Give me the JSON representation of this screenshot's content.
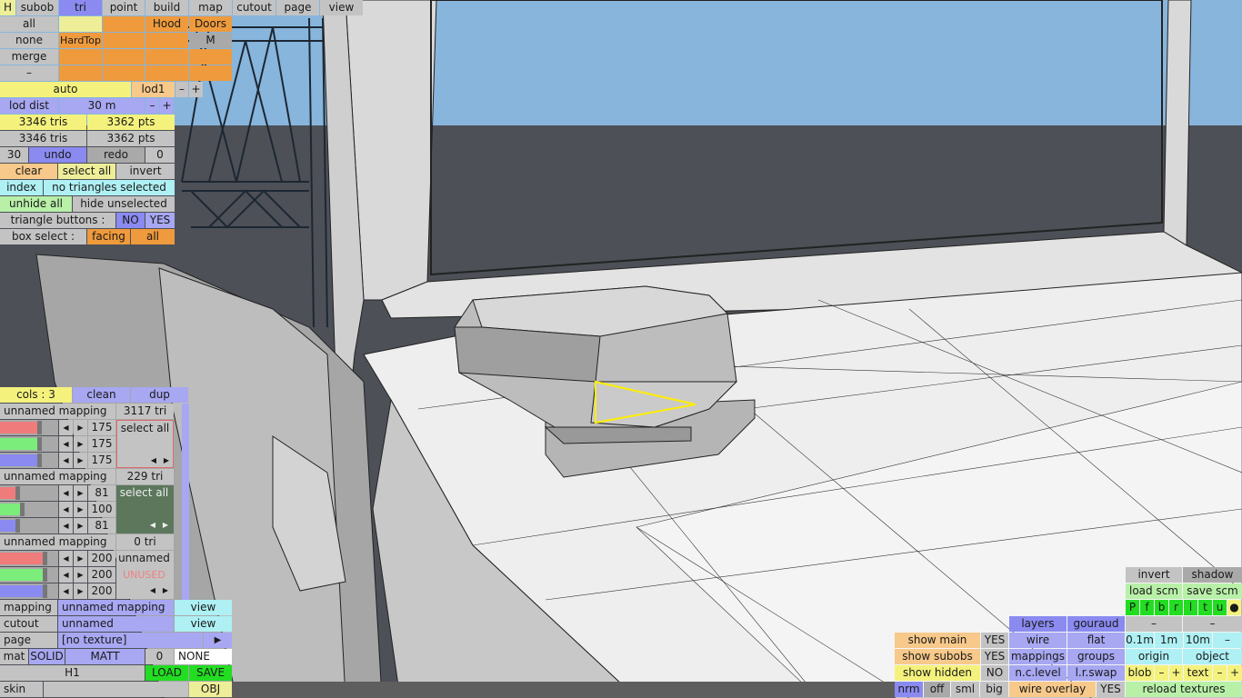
{
  "top_bar": {
    "h": "H",
    "subob": "subob",
    "tri": "tri",
    "point": "point",
    "build": "build",
    "map": "map",
    "cutout": "cutout",
    "page": "page",
    "view": "view"
  },
  "subob_grid": {
    "all": "all",
    "none": "none",
    "merge": "merge",
    "dash": "–",
    "hood": "Hood",
    "doors": "Doors",
    "hardtop": "HardTop",
    "m": "M"
  },
  "lod": {
    "auto": "auto",
    "lod1": "lod1",
    "minus": "–",
    "plus": "+",
    "dist_label": "lod dist",
    "dist_value": "30 m"
  },
  "stats": {
    "tris1": "3346 tris",
    "pts1": "3362 pts",
    "tris2": "3346 tris",
    "pts2": "3362 pts"
  },
  "undo_row": {
    "n1": "30",
    "undo": "undo",
    "redo": "redo",
    "n2": "0"
  },
  "select_row": {
    "clear": "clear",
    "select_all": "select all",
    "invert": "invert"
  },
  "index_row": {
    "index": "index",
    "status": "no triangles selected"
  },
  "hide_row": {
    "unhide": "unhide all",
    "hide": "hide unselected"
  },
  "tri_buttons": {
    "label": "triangle buttons :",
    "no": "NO",
    "yes": "YES"
  },
  "box_select": {
    "label": "box select :",
    "facing": "facing",
    "all": "all"
  },
  "cols": {
    "label": "cols : 3",
    "clean": "clean",
    "dup": "dup"
  },
  "mappings": [
    {
      "name": "unnamed mapping",
      "tri": "3117 tri",
      "r": "175",
      "g": "175",
      "b": "175",
      "swatch_label": "select all",
      "r_level": 0.69,
      "g_level": 0.69,
      "b_level": 0.69
    },
    {
      "name": "unnamed mapping",
      "tri": "229 tri",
      "r": "81",
      "g": "100",
      "b": "81",
      "swatch_label": "select all",
      "r_level": 0.32,
      "g_level": 0.39,
      "b_level": 0.32
    },
    {
      "name": "unnamed mapping",
      "tri": "0 tri",
      "r": "200",
      "g": "200",
      "b": "200",
      "swatch_label": "unnamed",
      "unused": "UNUSED",
      "r_level": 0.78,
      "g_level": 0.78,
      "b_level": 0.78
    }
  ],
  "bottom_left": {
    "mapping_label": "mapping",
    "mapping_value": "unnamed mapping",
    "view": "view",
    "cutout_label": "cutout",
    "cutout_value": "unnamed",
    "page_label": "page",
    "page_value": "[no texture]",
    "page_arrow": "▶",
    "mat": "mat",
    "solid": "SOLID",
    "matt": "MATT",
    "zero": "0",
    "none": "NONE",
    "h1": "H1",
    "load": "LOAD",
    "save": "SAVE",
    "skin": "skin",
    "obj": "OBJ"
  },
  "bottom_right": {
    "invert": "invert",
    "shadow": "shadow",
    "load_scm": "load scm",
    "save_scm": "save scm",
    "letters": [
      "P",
      "f",
      "b",
      "r",
      "l",
      "t",
      "u",
      "●"
    ],
    "layers": "layers",
    "gouraud": "gouraud",
    "dash": "–",
    "wire": "wire",
    "flat": "flat",
    "m01": "0.1m",
    "m1": "1m",
    "m10": "10m",
    "mappings": "mappings",
    "groups": "groups",
    "origin": "origin",
    "object": "object",
    "ncl": "n.c.level",
    "lrswap": "l.r.swap",
    "blob": "blob",
    "text": "text",
    "minus": "–",
    "plus": "+",
    "wire_overlay": "wire overlay",
    "yes": "YES",
    "reload": "reload textures",
    "show_main": "show main",
    "show_subobs": "show subobs",
    "show_hidden": "show hidden",
    "no": "NO",
    "nrm": "nrm",
    "off": "off",
    "sml": "sml",
    "big": "big"
  }
}
